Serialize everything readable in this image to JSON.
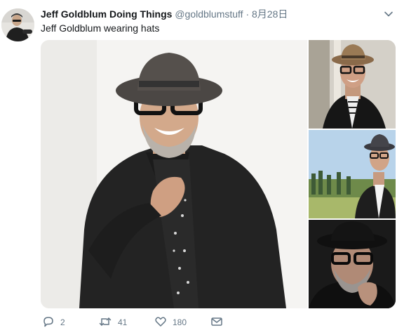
{
  "tweet": {
    "display_name": "Jeff Goldblum Doing Things",
    "handle": "@goldblumstuff",
    "separator": "·",
    "date": "8月28日",
    "text": "Jeff Goldblum wearing hats",
    "reply_count": "2",
    "retweet_count": "41",
    "like_count": "180"
  },
  "icons": {
    "caret": "chevron-down-icon",
    "reply": "reply-icon",
    "retweet": "retweet-icon",
    "like": "heart-icon",
    "message": "envelope-icon"
  },
  "colors": {
    "secondary_text": "#657786",
    "primary_text": "#14171a"
  }
}
